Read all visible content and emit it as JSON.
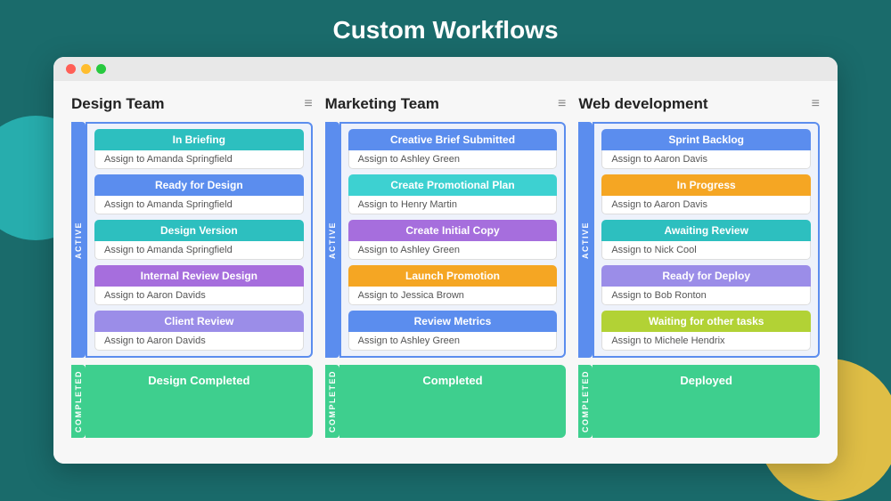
{
  "page": {
    "title": "Custom Workflows"
  },
  "columns": [
    {
      "id": "design",
      "title": "Design Team",
      "active_label": "ACTIVE",
      "completed_label": "COMPLETED",
      "tasks": [
        {
          "label": "In Briefing",
          "assignee": "Assign to Amanda Springfield",
          "color": "color-teal"
        },
        {
          "label": "Ready for Design",
          "assignee": "Assign to Amanda Springfield",
          "color": "color-blue"
        },
        {
          "label": "Design Version",
          "assignee": "Assign to Amanda Springfield",
          "color": "color-teal"
        },
        {
          "label": "Internal Review Design",
          "assignee": "Assign to Aaron Davids",
          "color": "color-purple"
        },
        {
          "label": "Client Review",
          "assignee": "Assign to Aaron Davids",
          "color": "color-lavender"
        }
      ],
      "completed": "Design Completed"
    },
    {
      "id": "marketing",
      "title": "Marketing Team",
      "active_label": "ACTIVE",
      "completed_label": "COMPLETED",
      "tasks": [
        {
          "label": "Creative Brief Submitted",
          "assignee": "Assign to Ashley Green",
          "color": "color-blue"
        },
        {
          "label": "Create Promotional Plan",
          "assignee": "Assign to Henry Martin",
          "color": "color-cyan"
        },
        {
          "label": "Create Initial Copy",
          "assignee": "Assign to Ashley Green",
          "color": "color-purple"
        },
        {
          "label": "Launch Promotion",
          "assignee": "Assign to Jessica Brown",
          "color": "color-orange"
        },
        {
          "label": "Review Metrics",
          "assignee": "Assign to Ashley Green",
          "color": "color-blue"
        }
      ],
      "completed": "Completed"
    },
    {
      "id": "webdev",
      "title": "Web development",
      "active_label": "ACTIVE",
      "completed_label": "COMPLETED",
      "tasks": [
        {
          "label": "Sprint Backlog",
          "assignee": "Assign to Aaron Davis",
          "color": "color-blue"
        },
        {
          "label": "In Progress",
          "assignee": "Assign to Aaron Davis",
          "color": "color-orange"
        },
        {
          "label": "Awaiting Review",
          "assignee": "Assign to Nick Cool",
          "color": "color-teal"
        },
        {
          "label": "Ready for Deploy",
          "assignee": "Assign to Bob Ronton",
          "color": "color-lavender"
        },
        {
          "label": "Waiting for other tasks",
          "assignee": "Assign to Michele Hendrix",
          "color": "color-yellow-green"
        }
      ],
      "completed": "Deployed"
    }
  ],
  "browser": {
    "dots": [
      "red",
      "yellow",
      "green"
    ]
  },
  "menu_icon": "≡"
}
